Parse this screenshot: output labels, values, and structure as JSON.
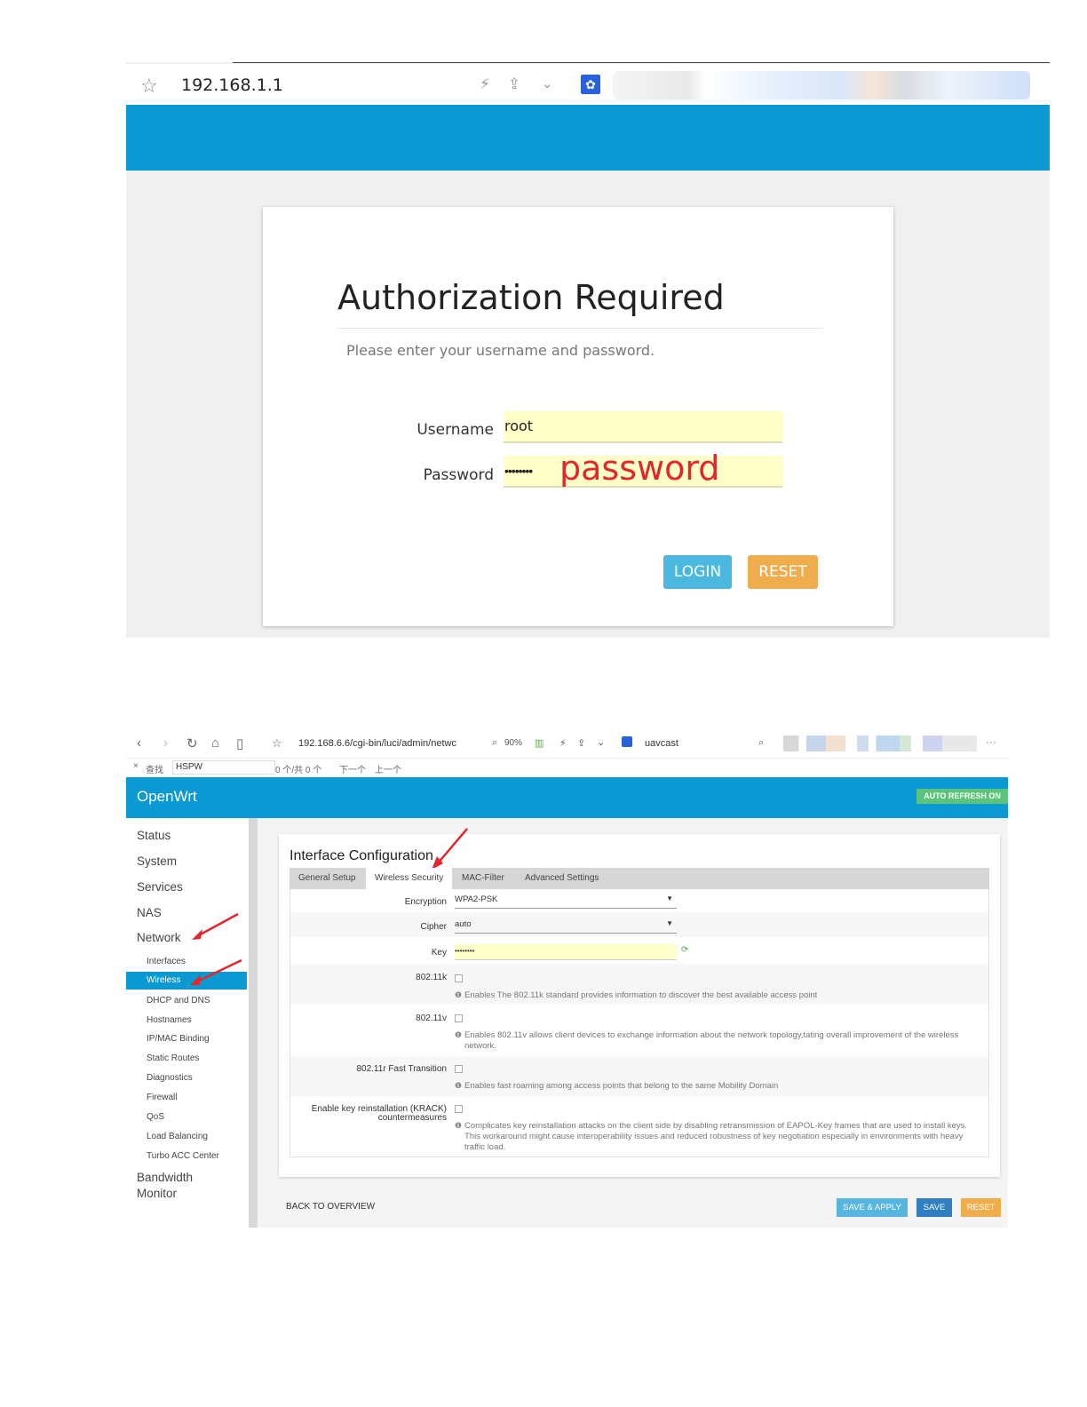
{
  "login_screen": {
    "address_bar": {
      "url": "192.168.1.1"
    },
    "title": "Authorization Required",
    "description": "Please enter your username and password.",
    "username": {
      "label": "Username",
      "value": "root"
    },
    "password": {
      "label": "Password",
      "value": "••••••••",
      "annotation": "password"
    },
    "buttons": {
      "login": "LOGIN",
      "reset": "RESET"
    }
  },
  "config_screen": {
    "browser": {
      "url": "192.168.6.6/cgi-bin/luci/admin/netwc",
      "zoom": "90%",
      "profile": "uavcast",
      "more": "···"
    },
    "find_bar": {
      "close": "×",
      "label": "查找",
      "query": "HSPW",
      "count": "0 个/共 0 个",
      "next": "下一个",
      "prev": "上一个"
    },
    "header": {
      "brand": "OpenWrt",
      "auto_refresh": "AUTO REFRESH ON"
    },
    "sidebar": {
      "menu": [
        "Status",
        "System",
        "Services",
        "NAS",
        "Network"
      ],
      "network_items": [
        "Interfaces",
        "Wireless",
        "DHCP and DNS",
        "Hostnames",
        "IP/MAC Binding",
        "Static Routes",
        "Diagnostics",
        "Firewall",
        "QoS",
        "Load Balancing",
        "Turbo ACC Center"
      ],
      "bandwidth_line1": "Bandwidth",
      "bandwidth_line2": "Monitor"
    },
    "panel": {
      "title": "Interface Configuration",
      "tabs": [
        "General Setup",
        "Wireless Security",
        "MAC-Filter",
        "Advanced Settings"
      ],
      "active_tab": "Wireless Security",
      "fields": {
        "encryption": {
          "label": "Encryption",
          "value": "WPA2-PSK"
        },
        "cipher": {
          "label": "Cipher",
          "value": "auto"
        },
        "key": {
          "label": "Key",
          "value": "••••••••"
        },
        "k802_11k": {
          "label": "802.11k",
          "help": "Enables The 802.11k standard provides information to discover the best available access point"
        },
        "k802_11v": {
          "label": "802.11v",
          "help": "Enables 802.11v allows client devices to exchange information about the network topology,tating overall improvement of the wireless network."
        },
        "k802_11r": {
          "label": "802.11r Fast Transition",
          "help": "Enables fast roaming among access points that belong to the same Mobility Domain"
        },
        "krack": {
          "label_line1": "Enable key reinstallation (KRACK)",
          "label_line2": "countermeasures",
          "help": "Complicates key reinstallation attacks on the client side by disabling retransmission of EAPOL-Key frames that are used to install keys. This workaround might cause interoperability issues and reduced robustness of key negotiation especially in environments with heavy traffic load."
        }
      }
    },
    "footer": {
      "back": "BACK TO OVERVIEW",
      "save_apply": "SAVE & APPLY",
      "save": "SAVE",
      "reset": "RESET"
    }
  }
}
